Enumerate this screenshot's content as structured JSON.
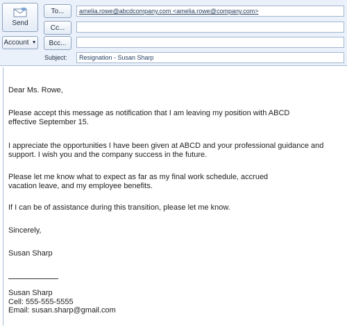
{
  "header": {
    "send_label": "Send",
    "to_label": "To...",
    "cc_label": "Cc...",
    "bcc_label": "Bcc...",
    "account_label": "Account",
    "to_value": "amelia.rowe@abcdcompany.com <amelia.rowe@company.com>",
    "cc_value": "",
    "bcc_value": "",
    "subject_label": "Subject:",
    "subject_value": "Resignation - Susan Sharp"
  },
  "body": {
    "greeting": "Dear Ms. Rowe,",
    "para1_line1": "Please accept this message as notification that I am leaving my position with ABCD",
    "para1_line2": "effective September 15.",
    "para2_line1": "I appreciate the opportunities I have been given at ABCD and your professional guidance and",
    "para2_line2": "support. I wish you and the company success in the future.",
    "para3_line1": "Please let me know what to expect as far as my final work schedule, accrued",
    "para3_line2": "vacation leave, and my employee benefits.",
    "para4": "If I can be of assistance during this transition, please let me know.",
    "closing": "Sincerely,",
    "signature": "Susan Sharp"
  },
  "signature_block": {
    "name": "Susan Sharp",
    "cell": "Cell: 555-555-5555",
    "email": "Email: susan.sharp@gmail.com"
  }
}
